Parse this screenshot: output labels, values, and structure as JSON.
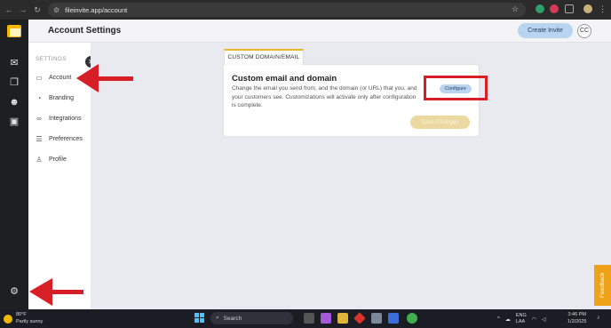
{
  "browser": {
    "url": "fileinvite.app/account"
  },
  "header": {
    "title": "Account Settings",
    "create_invite": "Create Invite",
    "avatar_initials": "CC"
  },
  "settings_nav": {
    "heading": "SETTINGS",
    "items": [
      {
        "label": "Account",
        "icon": "briefcase-icon"
      },
      {
        "label": "Branding",
        "icon": "palette-icon"
      },
      {
        "label": "Integrations",
        "icon": "link-icon"
      },
      {
        "label": "Preferences",
        "icon": "sliders-icon"
      },
      {
        "label": "Profile",
        "icon": "user-icon"
      }
    ]
  },
  "main": {
    "tab_label": "CUSTOM DOMAIN/EMAIL",
    "card_title": "Custom email and domain",
    "card_description": "Change the email you send from, and the domain (or URL) that you, and your customers see. Customizations will activate only after configuration is complete.",
    "configure_label": "Configure",
    "save_label": "Save Changes"
  },
  "feedback_label": "Feedback",
  "taskbar": {
    "temperature": "80°F",
    "weather": "Partly sunny",
    "search_placeholder": "Search",
    "lang_line1": "ENG",
    "lang_line2": "LAA",
    "time": "3:46 PM",
    "date": "1/2/2025"
  },
  "colors": {
    "accent_blue": "#b9d4f1",
    "annotation_red": "#d61f26",
    "feedback_orange": "#eea218",
    "tab_gold": "#e8b72a"
  }
}
